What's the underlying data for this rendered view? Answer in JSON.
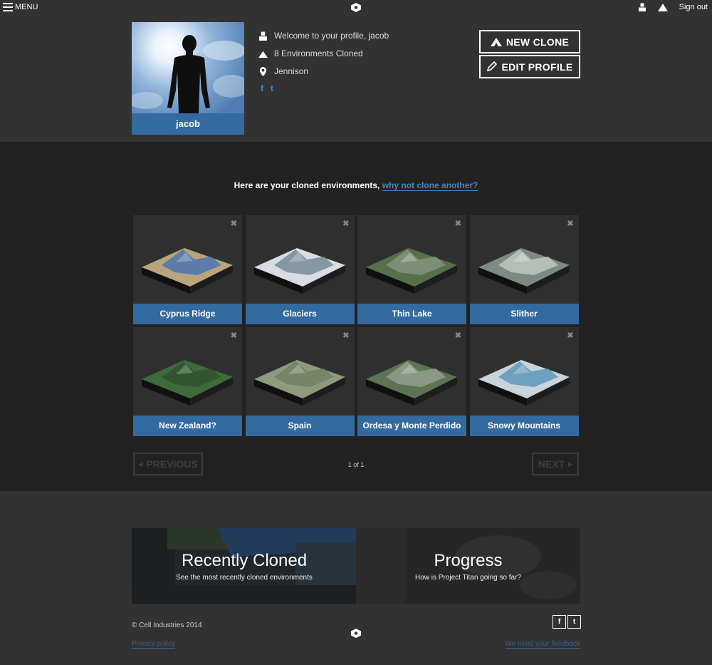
{
  "topbar": {
    "menu_label": "MENU",
    "sign_out_label": "Sign out"
  },
  "profile": {
    "name": "jacob",
    "welcome": "Welcome to your profile, jacob",
    "environments_cloned": "8 Environments Cloned",
    "location": "Jennison",
    "facebook_glyph": "f",
    "twitter_glyph": "t"
  },
  "actions": {
    "new_clone_label": "NEW CLONE",
    "edit_profile_label": "EDIT PROFILE"
  },
  "environments": {
    "heading_text": "Here are your cloned environments,",
    "heading_link": "why not clone another?",
    "items": [
      {
        "label": "Cyprus Ridge",
        "terrain": "coast"
      },
      {
        "label": "Glaciers",
        "terrain": "snow"
      },
      {
        "label": "Thin Lake",
        "terrain": "valley"
      },
      {
        "label": "Slither",
        "terrain": "grey"
      },
      {
        "label": "New Zealand?",
        "terrain": "forest"
      },
      {
        "label": "Spain",
        "terrain": "plain"
      },
      {
        "label": "Ordesa y Monte Perdido",
        "terrain": "mountain"
      },
      {
        "label": "Snowy Mountains",
        "terrain": "snowlake"
      }
    ],
    "close_glyph": "✖"
  },
  "pagination": {
    "previous_label": "PREVIOUS",
    "next_label": "NEXT",
    "page_info": "1 of 1"
  },
  "promos": [
    {
      "title": "Recently Cloned",
      "subtitle": "See the most recently cloned environments"
    },
    {
      "title": "Progress",
      "subtitle": "How is Project Titan going so far?"
    }
  ],
  "footer": {
    "copyright": "© Cell Industries 2014",
    "privacy": "Privacy policy",
    "feedback": "We need your feedback",
    "facebook_glyph": "f",
    "twitter_glyph": "t"
  },
  "colors": {
    "accent": "#336a9f",
    "link": "#4b83c4",
    "background": "#323232",
    "section_background": "#222222"
  }
}
